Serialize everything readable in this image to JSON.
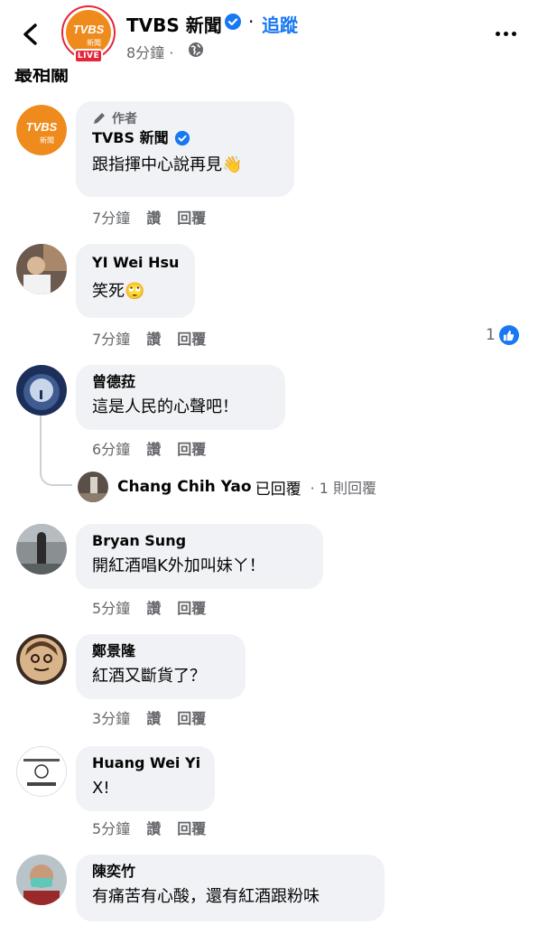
{
  "header": {
    "page_name": "TVBS 新聞",
    "dot": "·",
    "follow_label": "追蹤",
    "post_time": "8分鐘 ·",
    "live_label": "LIVE",
    "logo_text": "TVBS",
    "logo_sub": "新聞",
    "section_title": "最相關"
  },
  "comments": [
    {
      "author_badge": "作者",
      "name": "TVBS 新聞",
      "text": "跟指揮中心說再見👋",
      "time": "7分鐘",
      "like": "讚",
      "reply": "回覆"
    },
    {
      "name": "YI Wei Hsu",
      "text": "笑死🙄",
      "time": "7分鐘",
      "like": "讚",
      "reply": "回覆",
      "reaction_count": "1"
    },
    {
      "name": "曾德菈",
      "text": "這是人民的心聲吧！",
      "time": "6分鐘",
      "like": "讚",
      "reply": "回覆",
      "reply_preview": {
        "name": "Chang Chih Yao",
        "action": "已回覆",
        "count": "· 1 則回覆"
      }
    },
    {
      "name": "Bryan Sung",
      "text": "開紅酒唱K外加叫妹ㄚ！",
      "time": "5分鐘",
      "like": "讚",
      "reply": "回覆"
    },
    {
      "name": "鄭景隆",
      "text": "紅酒又斷貨了？",
      "time": "3分鐘",
      "like": "讚",
      "reply": "回覆"
    },
    {
      "name": "Huang Wei Yi",
      "text": "X!",
      "time": "5分鐘",
      "like": "讚",
      "reply": "回覆"
    },
    {
      "name": "陳奕竹",
      "text": "有痛苦有心酸，還有紅酒跟粉味"
    }
  ],
  "colors": {
    "accent": "#1877f2",
    "brand": "#e4263a",
    "bubble": "#f0f2f5",
    "secondary_text": "#65676b"
  }
}
